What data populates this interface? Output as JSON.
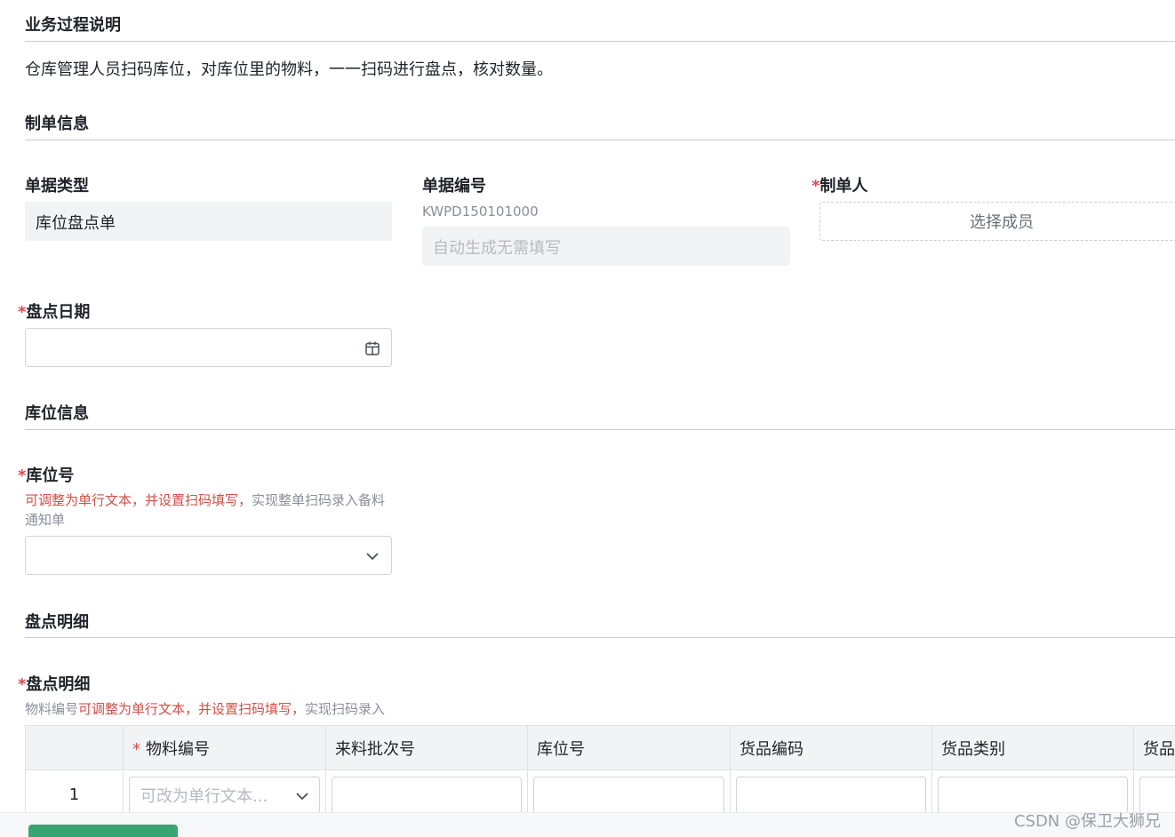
{
  "sections": {
    "process": {
      "title": "业务过程说明",
      "description": "仓库管理人员扫码库位，对库位里的物料，一一扫码进行盘点，核对数量。"
    },
    "order_info": {
      "title": "制单信息",
      "doc_type": {
        "label": "单据类型",
        "value": "库位盘点单"
      },
      "doc_number": {
        "label": "单据编号",
        "code": "KWPD150101000",
        "placeholder": "自动生成无需填写"
      },
      "creator": {
        "required_mark": "*",
        "label": "制单人",
        "button": "选择成员"
      },
      "stock_date": {
        "required_mark": "*",
        "label": "盘点日期",
        "value": "",
        "icon": "calendar-icon"
      }
    },
    "location_info": {
      "title": "库位信息",
      "location_no": {
        "required_mark": "*",
        "label": "库位号",
        "hint_red": "可调整为单行文本，并设置扫码填写，",
        "hint_gray": "实现整单扫码录入备料通知单",
        "value": "",
        "icon": "chevron-down-icon"
      }
    },
    "detail": {
      "title": "盘点明细",
      "field": {
        "required_mark": "*",
        "label": "盘点明细",
        "hint_prefix": "物料编号",
        "hint_red": "可调整为单行文本，并设置扫码填写，",
        "hint_suffix": "实现扫码录入"
      },
      "table": {
        "columns": [
          {
            "label": "",
            "required": false
          },
          {
            "label": "物料编号",
            "required": true,
            "required_mark": "*"
          },
          {
            "label": "来料批次号",
            "required": false
          },
          {
            "label": "库位号",
            "required": false
          },
          {
            "label": "货品编码",
            "required": false
          },
          {
            "label": "货品类别",
            "required": false
          },
          {
            "label": "货品",
            "required": false
          }
        ],
        "rows": [
          {
            "index": "1",
            "material_placeholder": "可改为单行文本...",
            "material_icon": "chevron-down-icon"
          }
        ]
      }
    }
  },
  "watermark": "CSDN @保卫大狮兄"
}
